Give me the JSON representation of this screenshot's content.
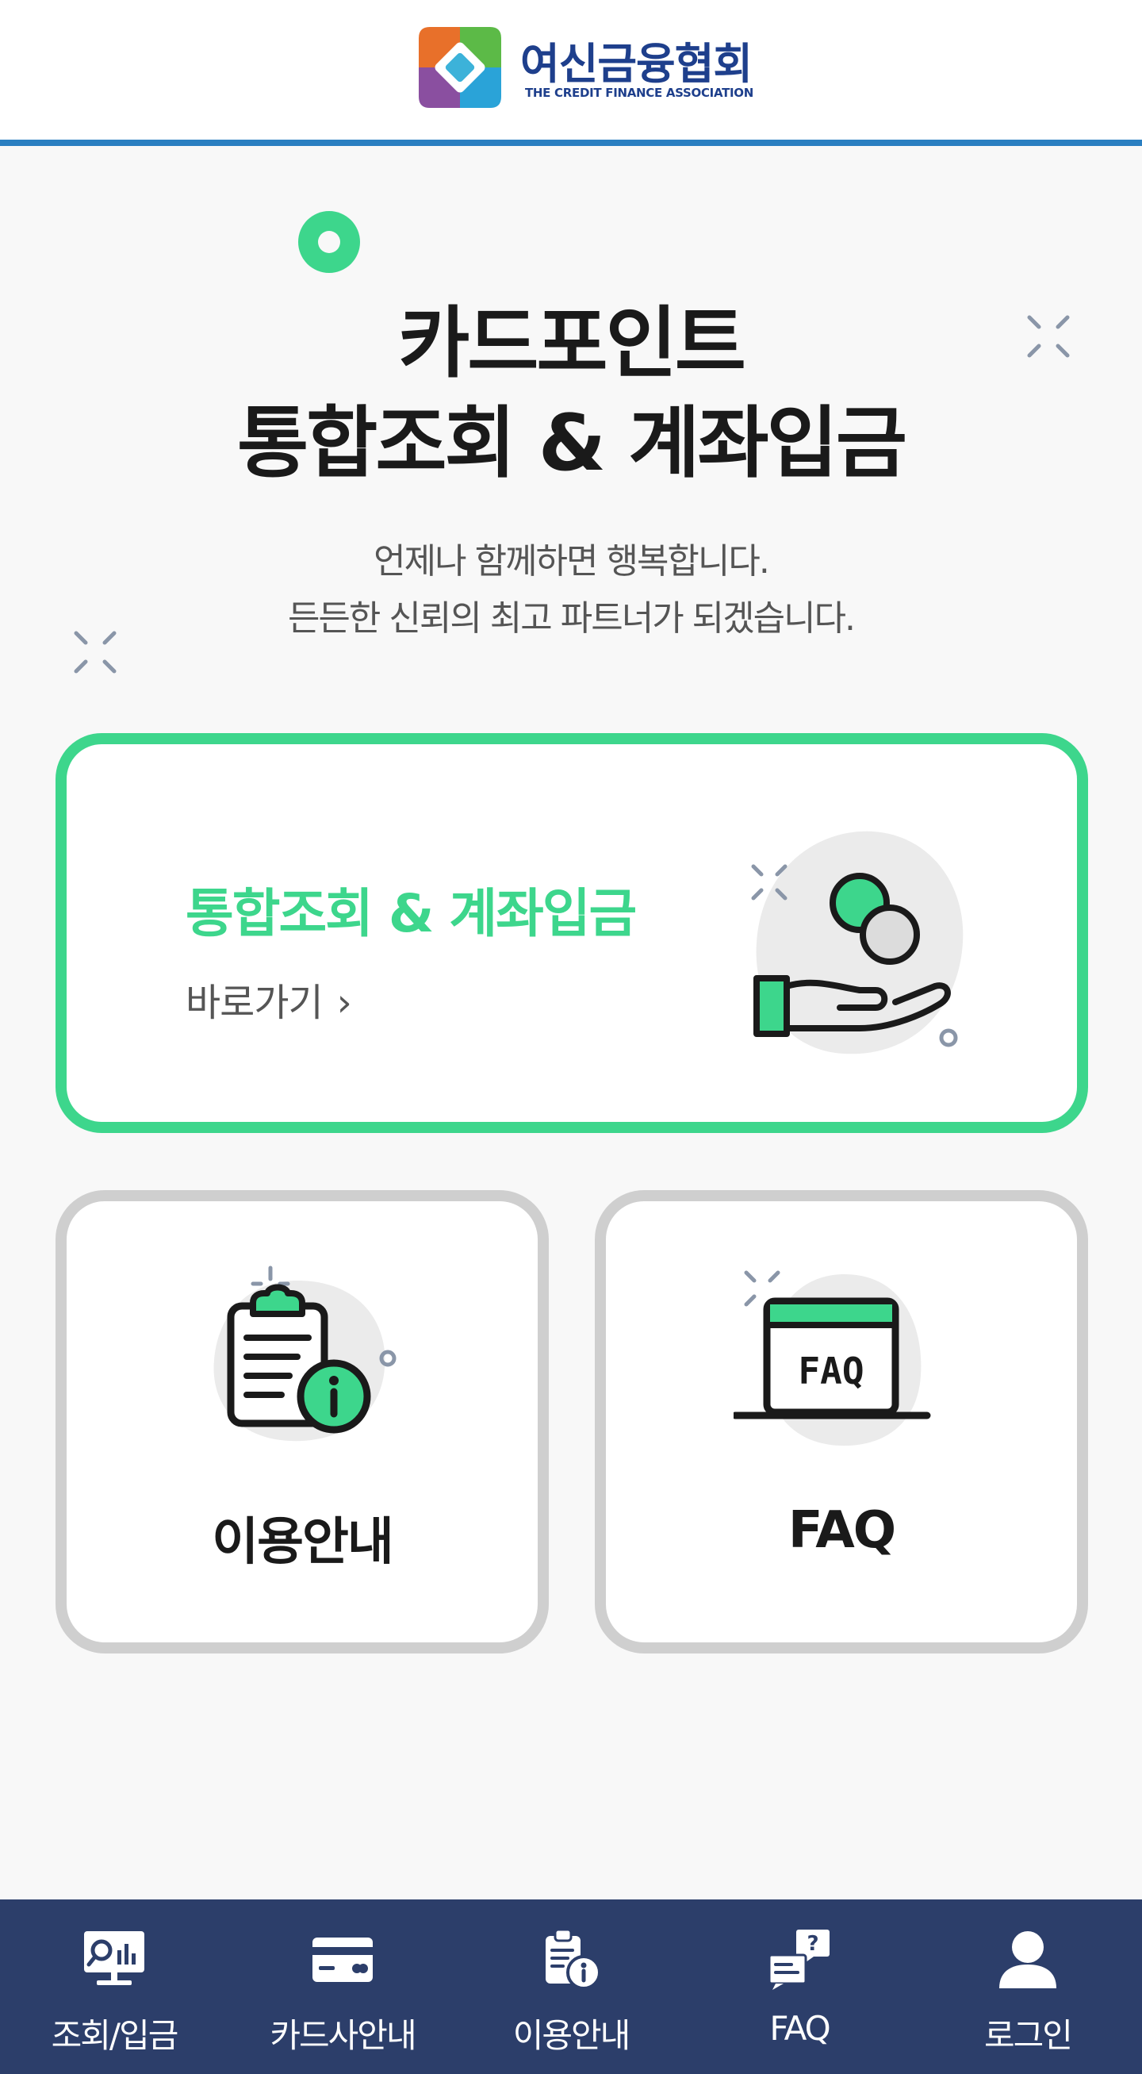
{
  "header": {
    "logo_name_ko": "여신금융협회",
    "logo_name_en": "THE CREDIT FINANCE ASSOCIATION"
  },
  "hero": {
    "title_line1": "카드포인트",
    "title_line2": "통합조회 & 계좌입금",
    "subtitle_line1": "언제나 함께하면 행복합니다.",
    "subtitle_line2": "든든한 신뢰의 최고 파트너가 되겠습니다."
  },
  "main_card": {
    "title": "통합조회 & 계좌입금",
    "link_label": "바로가기",
    "chevron": "›",
    "icon": "coins-hand-icon"
  },
  "sub_cards": [
    {
      "label": "이용안내",
      "icon": "clipboard-info-icon"
    },
    {
      "label": "FAQ",
      "icon": "faq-window-icon"
    }
  ],
  "bottom_nav": {
    "items": [
      {
        "label": "조회/입금",
        "icon": "monitor-search-icon"
      },
      {
        "label": "카드사안내",
        "icon": "card-icon"
      },
      {
        "label": "이용안내",
        "icon": "clipboard-info-icon"
      },
      {
        "label": "FAQ",
        "icon": "chat-question-icon"
      },
      {
        "label": "로그인",
        "icon": "user-icon"
      }
    ]
  },
  "faq_icon_text": "FAQ",
  "faq_nav_icon_text": "?",
  "colors": {
    "accent_green": "#3dd68c",
    "header_line_blue": "#2a7fc1",
    "nav_background": "#2c3e6a",
    "logo_blue": "#1e3f8c",
    "card_border_gray": "#cfcfcf",
    "page_background": "#f8f8f8"
  }
}
